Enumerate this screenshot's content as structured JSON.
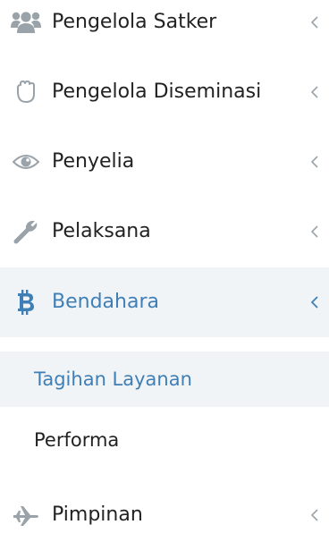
{
  "menu": {
    "items": [
      {
        "label": "Pengelola Satker",
        "icon": "users-icon"
      },
      {
        "label": "Pengelola Diseminasi",
        "icon": "hand-paper-icon"
      },
      {
        "label": "Penyelia",
        "icon": "eye-icon"
      },
      {
        "label": "Pelaksana",
        "icon": "wrench-icon"
      },
      {
        "label": "Bendahara",
        "icon": "bitcoin-icon",
        "active": true,
        "expanded": true
      },
      {
        "label": "Pimpinan",
        "icon": "plane-icon"
      }
    ],
    "bendahara_submenu": [
      {
        "label": "Tagihan Layanan",
        "active": true
      },
      {
        "label": "Performa"
      }
    ]
  },
  "colors": {
    "accent": "#3f7fb6",
    "icon_gray": "#9aa3a9",
    "active_bg": "#f1f4f7",
    "text": "#222222"
  }
}
